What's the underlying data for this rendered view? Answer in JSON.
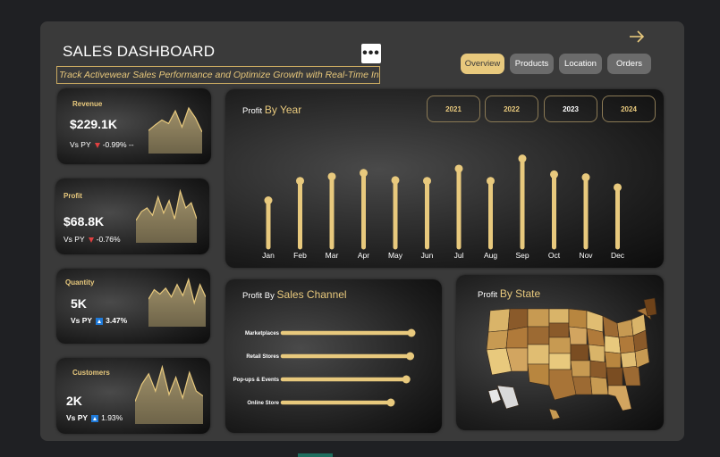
{
  "header": {
    "title": "SALES DASHBOARD",
    "subtitle": "Track Activewear Sales Performance and Optimize Growth with Real-Time Insights",
    "more_label": "•••"
  },
  "nav_tabs": [
    {
      "label": "Overview",
      "active": true
    },
    {
      "label": "Products",
      "active": false
    },
    {
      "label": "Location",
      "active": false
    },
    {
      "label": "Orders",
      "active": false
    }
  ],
  "kpis": {
    "revenue": {
      "label": "Revenue",
      "value": "$229.1K",
      "vs": "Vs PY",
      "delta": "-0.99% --",
      "direction": "down"
    },
    "profit": {
      "label": "Profit",
      "value": "$68.8K",
      "vs": "Vs PY",
      "delta": "-0.76%",
      "direction": "down"
    },
    "quantity": {
      "label": "Quantity",
      "value": "5K",
      "vs": "Vs PY",
      "delta": "3.47%",
      "direction": "up"
    },
    "customers": {
      "label": "Customers",
      "value": "2K",
      "vs": "Vs PY",
      "delta": "1.93%",
      "direction": "up"
    }
  },
  "profit_by_year": {
    "title_prefix": "Profit",
    "title_accent": "By Year",
    "years": [
      {
        "label": "2021",
        "selected": false
      },
      {
        "label": "2022",
        "selected": false
      },
      {
        "label": "2023",
        "selected": true
      },
      {
        "label": "2024",
        "selected": false
      }
    ]
  },
  "profit_by_channel": {
    "title_prefix": "Profit By",
    "title_accent": "Sales Channel"
  },
  "profit_by_state": {
    "title_prefix": "Profit",
    "title_accent": "By State"
  },
  "colors": {
    "accent": "#e8c97d",
    "frame": "#3a3a3a",
    "background": "#1f2023",
    "map_dark": "#7a4d22",
    "map_light": "#e8c97d"
  },
  "chart_data": [
    {
      "type": "bar",
      "name": "profit-by-month",
      "categories": [
        "Jan",
        "Feb",
        "Mar",
        "Apr",
        "May",
        "Jun",
        "Jul",
        "Aug",
        "Sep",
        "Oct",
        "Nov",
        "Dec"
      ],
      "values": [
        65,
        92,
        98,
        103,
        93,
        92,
        109,
        92,
        123,
        101,
        97,
        83
      ],
      "ylim": [
        0,
        130
      ],
      "grid": false
    },
    {
      "type": "bar",
      "name": "profit-by-sales-channel",
      "orientation": "horizontal",
      "categories": [
        "Marketplaces",
        "Retail Stores",
        "Pop-ups & Events",
        "Online Store"
      ],
      "values": [
        100,
        99,
        96,
        84
      ],
      "xlim": [
        0,
        100
      ]
    }
  ],
  "sparklines": {
    "revenue": [
      30,
      38,
      45,
      40,
      58,
      35,
      62,
      48,
      28
    ],
    "profit": [
      28,
      40,
      45,
      35,
      60,
      38,
      55,
      30,
      68,
      45,
      52,
      30
    ],
    "quantity": [
      35,
      48,
      42,
      50,
      38,
      55,
      40,
      62,
      30,
      55,
      38
    ],
    "customers": [
      30,
      55,
      70,
      45,
      80,
      40,
      65,
      35,
      72,
      45,
      38
    ]
  }
}
